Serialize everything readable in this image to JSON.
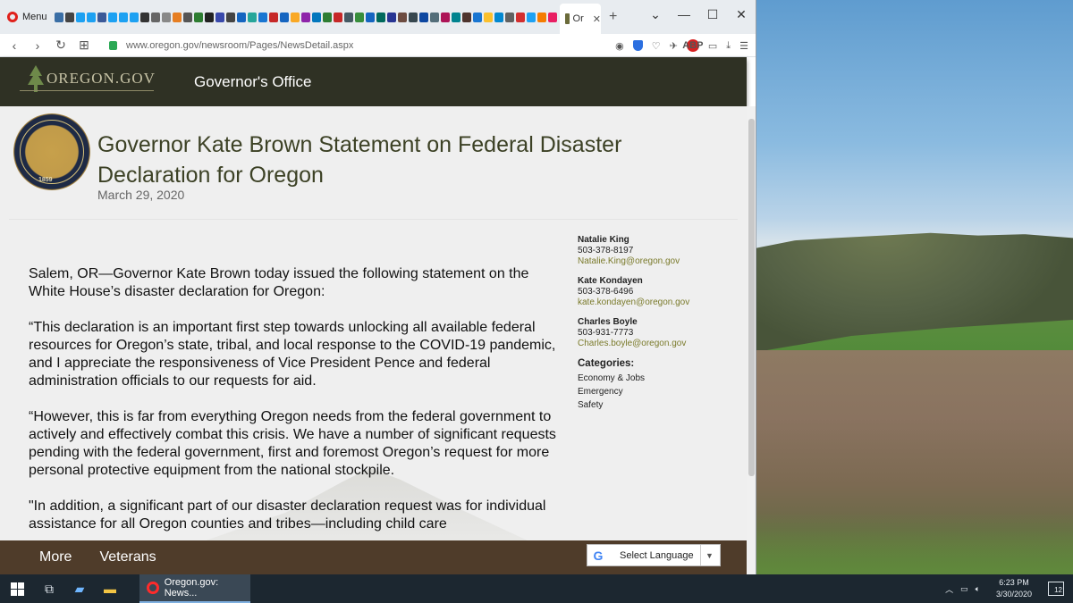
{
  "browser": {
    "menu_label": "Menu",
    "active_tab_label": "Or",
    "url": "www.oregon.gov/newsroom/Pages/NewsDetail.aspx"
  },
  "site": {
    "logo_text": "OREGON.GOV",
    "office_name": "Governor's Office"
  },
  "article": {
    "title": "Governor Kate Brown Statement on Federal Disaster Declaration for Oregon",
    "date": "March 29, 2020",
    "seal_year": "1859",
    "paragraphs": [
      "Salem, OR—Governor Kate Brown today issued the following statement on the White House’s disaster declaration for Oregon:",
      "“This declaration is an important first step towards unlocking all available federal resources for Oregon’s state, tribal, and local response to the COVID-19 pandemic, and I appreciate the responsiveness of Vice President Pence and federal administration officials to our requests for aid.",
      "“However, this is far from everything Oregon needs from the federal government to actively and effectively combat this crisis. We have a number of significant requests pending with the federal government, first and foremost Oregon’s request for more personal protective equipment from the national stockpile.",
      "\"In addition, a significant part of our disaster declaration request was for individual assistance for all Oregon counties and tribes—including child care"
    ]
  },
  "contacts": [
    {
      "name": "Natalie King",
      "phone": "503-378-8197",
      "email": "Natalie.King@oregon.gov"
    },
    {
      "name": "Kate Kondayen",
      "phone": "503-378-6496",
      "email": "kate.kondayen@oregon.gov"
    },
    {
      "name": "Charles Boyle",
      "phone": "503-931-7773",
      "email": "Charles.boyle@oregon.gov"
    }
  ],
  "categories": {
    "heading": "Categories:",
    "items": [
      "Economy & Jobs",
      "Emergency",
      "Safety"
    ]
  },
  "footer": {
    "links": [
      "More",
      "Veterans"
    ],
    "language_label": "Select Language",
    "google_letter": "G"
  },
  "taskbar": {
    "app_label": "Oregon.gov: News...",
    "time": "6:23 PM",
    "date": "3/30/2020",
    "notification_count": "12"
  },
  "colors": {
    "header_bg": "#2f3124",
    "footer_bg": "#4f3c2a",
    "title_color": "#3c4125",
    "email_color": "#7a7a2a"
  }
}
